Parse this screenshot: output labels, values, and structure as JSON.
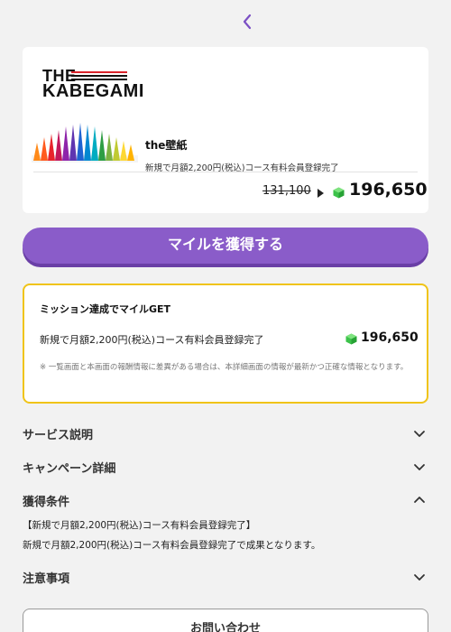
{
  "offer": {
    "logo_line1": "THE",
    "logo_line2": "KABEGAMI",
    "title": "the壁紙",
    "description": "新規で月額2,200円(税込)コース有料会員登録完了",
    "old_points": "131,100",
    "new_points": "196,650"
  },
  "cta": {
    "label": "マイルを獲得する"
  },
  "mission": {
    "title": "ミッション達成でマイルGET",
    "description": "新規で月額2,200円(税込)コース有料会員登録完了",
    "points": "196,650",
    "note": "※ 一覧画面と本画面の報酬情報に差異がある場合は、本詳細画面の情報が最新かつ正確な情報となります。"
  },
  "sections": {
    "service": "サービス説明",
    "campaign": "キャンペーン詳細",
    "conditions": "獲得条件",
    "notes": "注意事項"
  },
  "conditions": {
    "line1": "【新規で月額2,200円(税込)コース有料会員登録完了】",
    "line2": "新規で月額2,200円(税込)コース有料会員登録完了で成果となります。"
  },
  "contact": {
    "label": "お問い合わせ"
  },
  "colors": {
    "accent": "#8a5cc9",
    "mission_border": "#f0c419",
    "gem": "#3cc24a"
  },
  "icons": {
    "back": "chevron-left-icon",
    "expand": "chevron-down-icon",
    "collapse": "chevron-up-icon",
    "points": "green-gem-icon"
  }
}
